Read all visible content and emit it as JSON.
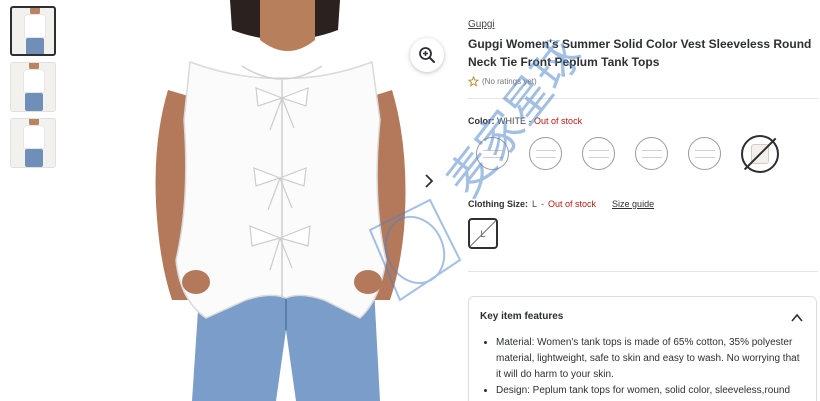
{
  "thumbnails": [
    {
      "label": "product image 1",
      "selected": true
    },
    {
      "label": "product image 2",
      "selected": false
    },
    {
      "label": "product image 3",
      "selected": false
    }
  ],
  "product": {
    "brand": "Gupgi",
    "title": "Gupgi Women's Summer Solid Color Vest Sleeveless Round Neck Tie Front Peplum Tank Tops",
    "rating_text": "(No ratings yet)"
  },
  "color": {
    "label": "Color:",
    "selected": "WHITE",
    "separator": "-",
    "status": "Out of stock",
    "swatch_count": 6
  },
  "size": {
    "label": "Clothing Size:",
    "selected": "L",
    "separator": "-",
    "status": "Out of stock",
    "guide_label": "Size guide",
    "options": [
      "L"
    ]
  },
  "features": {
    "heading": "Key item features",
    "items": [
      "Material: Women's tank tops is made of 65% cotton, 35% polyester material, lightweight, safe to skin and easy to wash. No worrying that it will do harm to your skin.",
      "Design: Peplum tank tops for women, solid color, sleeveless,round"
    ]
  },
  "watermark_text": "麦家星球",
  "colors": {
    "text": "#2e2f32",
    "out_of_stock": "#b51a12",
    "border": "#dcdde0",
    "watermark": "#4a82c8"
  },
  "icons": {
    "zoom": "zoom-in-icon",
    "next": "chevron-right-icon",
    "star": "star-outline-icon",
    "collapse": "chevron-up-icon"
  }
}
